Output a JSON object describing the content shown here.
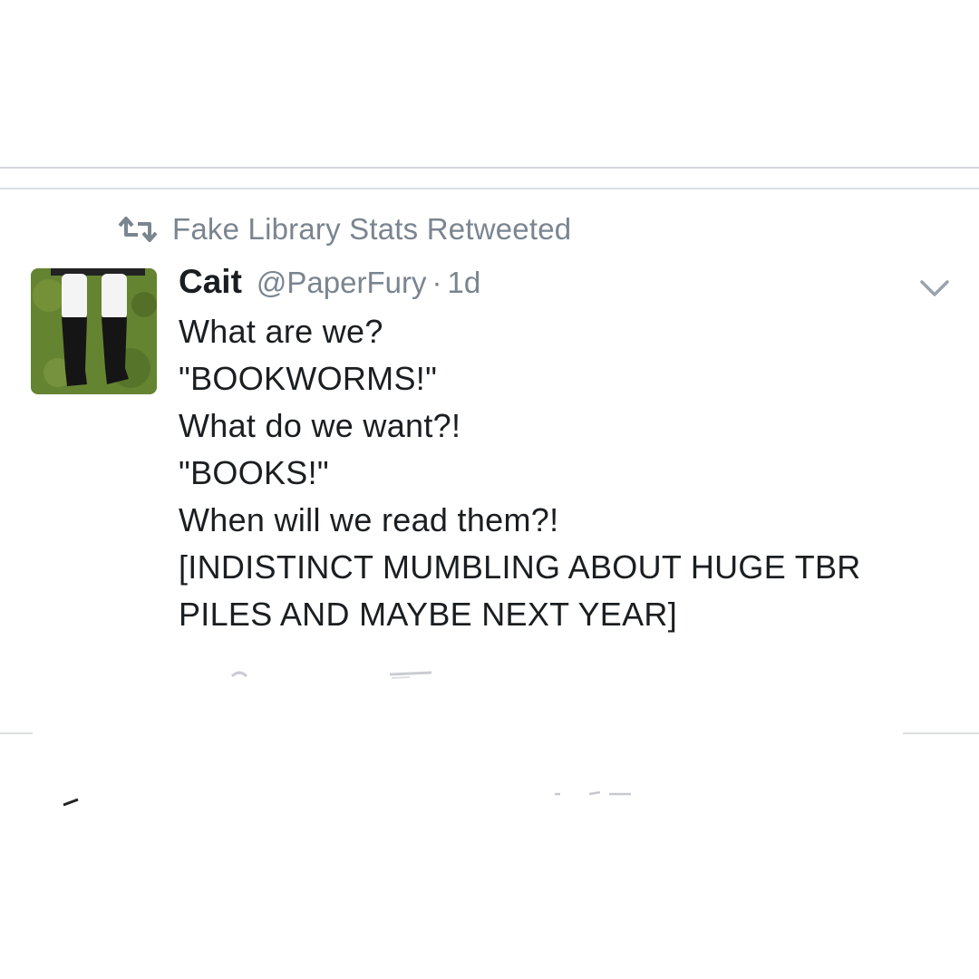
{
  "retweet": {
    "icon": "retweet-icon",
    "text": "Fake Library Stats Retweeted"
  },
  "tweet": {
    "avatar": "avatar-photo",
    "display_name": "Cait",
    "handle": "@PaperFury",
    "separator": "·",
    "age": "1d",
    "menu_icon": "chevron-down-icon",
    "lines": [
      "What are we?",
      "\"BOOKWORMS!\"",
      "What do we want?!",
      "\"BOOKS!\"",
      "When will we read them?!",
      "[INDISTINCT MUMBLING ABOUT HUGE TBR",
      "PILES AND MAYBE NEXT YEAR]"
    ]
  },
  "colors": {
    "text": "#1b1e21",
    "secondary": "#7a8590",
    "divider": "#dcdee2"
  }
}
